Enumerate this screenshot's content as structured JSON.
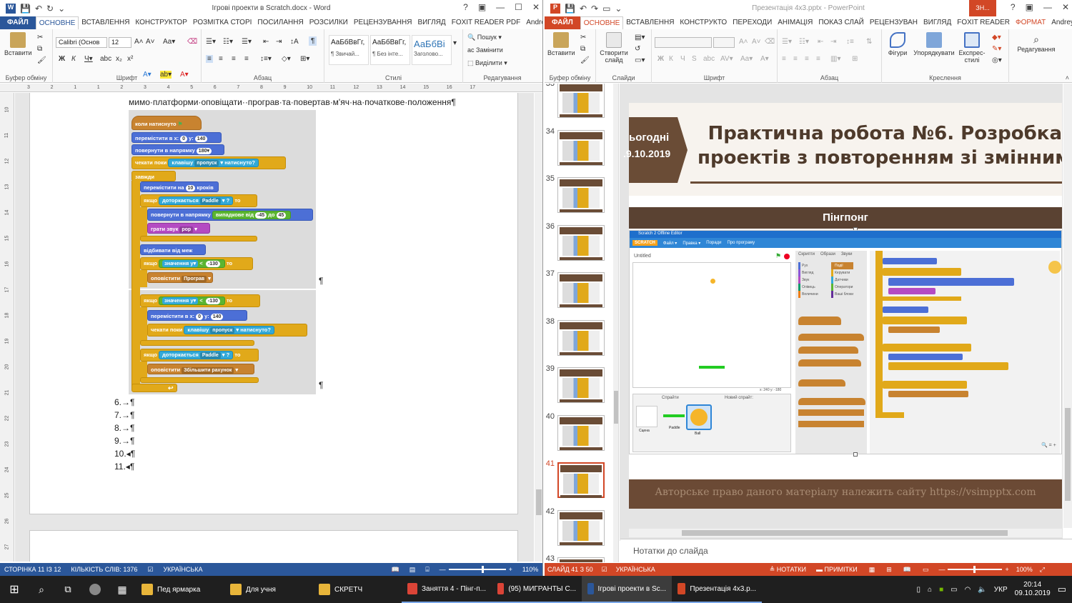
{
  "word": {
    "title": "Ігрові проекти в Scratch.docx - Word",
    "file_tab": "ФАЙЛ",
    "tabs": [
      "ОСНОВНЕ",
      "ВСТАВЛЕННЯ",
      "КОНСТРУКТОР",
      "РОЗМІТКА СТОРІ",
      "ПОСИЛАННЯ",
      "РОЗСИЛКИ",
      "РЕЦЕНЗУВАННЯ",
      "ВИГЛЯД",
      "FOXIT READER PDF"
    ],
    "user": "Andrey Se...",
    "groups": {
      "clipboard": "Буфер обміну",
      "font": "Шрифт",
      "paragraph": "Абзац",
      "styles": "Стилі",
      "editing": "Редагування"
    },
    "paste_label": "Вставити",
    "font_name": "Calibri (Основ",
    "font_size": "12",
    "styles": [
      {
        "preview": "АаБбВвГг,",
        "name": "¶ Звичай..."
      },
      {
        "preview": "АаБбВвГг,",
        "name": "¶ Без інте..."
      },
      {
        "preview": "АаБбВі",
        "name": "Заголово..."
      }
    ],
    "editing": {
      "find": "Пошук",
      "replace": "Замінити",
      "select": "Виділити"
    },
    "ruler_nums": [
      "3",
      "2",
      "1",
      "1",
      "2",
      "3",
      "4",
      "5",
      "6",
      "7",
      "8",
      "9",
      "10",
      "11",
      "12",
      "13",
      "14",
      "15",
      "16",
      "17"
    ],
    "vruler_nums": [
      "10",
      "11",
      "12",
      "13",
      "14",
      "15",
      "16",
      "17",
      "18",
      "19",
      "20",
      "21",
      "22",
      "23",
      "24",
      "25",
      "26",
      "27"
    ],
    "doc_text": "мимо·платформи·оповіщати··програв·та·повертав·м'яч·на·початкове·положення¶",
    "pilcrow": "¶",
    "scratch": {
      "when_clicked": "коли",
      "clicked": "натиснуто",
      "goto": "перемістити в x:",
      "y_label": "y:",
      "x0": "0",
      "y140": "140",
      "point_dir": "повернути в напрямку",
      "dir180": "180▾",
      "wait_until": "чекати поки",
      "key": "клавішу",
      "space": "пропуск",
      "pressed": "натиснуто?",
      "forever": "завжди",
      "move": "перемістити на",
      "steps10": "10",
      "steps": "кроків",
      "if": "якщо",
      "touching": "доторкається",
      "paddle": "Paddle",
      "q": "?",
      "then": "то",
      "random": "випадкове від",
      "to": "до",
      "r1": "-45",
      "r2": "45",
      "play": "грати звук",
      "pop": "pop",
      "bounce": "відбивати від меж",
      "value": "значення",
      "y_sym": "у",
      "lt": "<",
      "m130": "-130",
      "broadcast": "оповістити",
      "lost": "Програв",
      "score": "Збільшити рахунок"
    },
    "list": [
      "6.→¶",
      "7.→¶",
      "8.→¶",
      "9.→¶",
      "10.◂¶",
      "11.◂¶"
    ],
    "status": {
      "page": "СТОРІНКА 11 ІЗ 12",
      "words": "КІЛЬКІСТЬ СЛІВ: 1376",
      "lang": "УКРАЇНСЬКА",
      "zoom": "110%"
    }
  },
  "ppt": {
    "title": "Презентація 4x3.pptx - PowerPoint",
    "file_tab": "ФАЙЛ",
    "tabs": [
      "ОСНОВНЕ",
      "ВСТАВЛЕННЯ",
      "КОНСТРУКТО",
      "ПЕРЕХОДИ",
      "АНІМАЦІЯ",
      "ПОКАЗ СЛАЙ",
      "РЕЦЕНЗУВАН",
      "ВИГЛЯД",
      "FOXIT READER",
      "ФОРМАТ"
    ],
    "context_tab": "ЗН...",
    "user": "Andrey Se...",
    "groups": {
      "clipboard": "Буфер обміну",
      "slides": "Слайди",
      "font": "Шрифт",
      "paragraph": "Абзац",
      "drawing": "Креслення",
      "editing": "Редагування"
    },
    "paste_label": "Вставити",
    "new_slide": "Створити слайд",
    "shapes": "Фігури",
    "arrange": "Упорядкувати",
    "quick_styles": "Експрес-стилі",
    "editing": "Редагування",
    "thumb_nums": [
      "33",
      "34",
      "35",
      "36",
      "37",
      "38",
      "39",
      "40",
      "41",
      "42",
      "43"
    ],
    "slide": {
      "date_top": "ьогодні",
      "date_bottom": ".9.10.2019",
      "title_line1": "Практична робота №6. Розробка",
      "title_line2": "проектів з повторенням зі змінним",
      "section": "Пінгпонг",
      "copyright": "Авторське право даного матеріалу належить сайту https://vsimpptx.com"
    },
    "scratch_app": {
      "title": "Scratch 2 Offline Editor",
      "logo": "SCRATCH",
      "menu": [
        "Файл ▾",
        "Правка ▾",
        "Поради",
        "Про програму"
      ],
      "project": "Untitled",
      "tabs": [
        "Скрипти",
        "Образи",
        "Звуки"
      ],
      "categories": [
        "Рух",
        "Вигляд",
        "Звук",
        "Олівець",
        "Величини"
      ],
      "categories2": [
        "Події",
        "Керувати",
        "Датчики",
        "Оператори",
        "Ваші блоки"
      ],
      "sprites_label": "Спрайти",
      "new_sprite": "Новий спрайт:",
      "stage": "Сцена",
      "paddle": "Paddle",
      "ball": "Ball",
      "coords": "x: 240  y: -180"
    },
    "notes": "Нотатки до слайда",
    "status": {
      "slide": "СЛАЙД 41 З 50",
      "lang": "УКРАЇНСЬКА",
      "notes": "НОТАТКИ",
      "comments": "ПРИМІТКИ",
      "zoom": "100%"
    }
  },
  "taskbar": {
    "items": [
      {
        "label": "Пед ярмарка",
        "color": "#e8b53a"
      },
      {
        "label": "Для учня",
        "color": "#e8b53a"
      },
      {
        "label": "СКРЕТЧ",
        "color": "#e8b53a"
      },
      {
        "label": "Заняття 4 - Пінг-п...",
        "color": "#db4437"
      },
      {
        "label": "(95) МИГРАНТЫ С...",
        "color": "#db4437"
      },
      {
        "label": "Ігрові проекти в Sc...",
        "color": "#2b579a"
      },
      {
        "label": "Презентація 4x3.p...",
        "color": "#d24726"
      }
    ],
    "lang": "УКР",
    "time": "20:14",
    "date": "09.10.2019"
  },
  "colors": {
    "word": "#2b579a",
    "ppt": "#d24726",
    "slide_brown": "#5a4232",
    "slide_band": "#6b4a35"
  }
}
